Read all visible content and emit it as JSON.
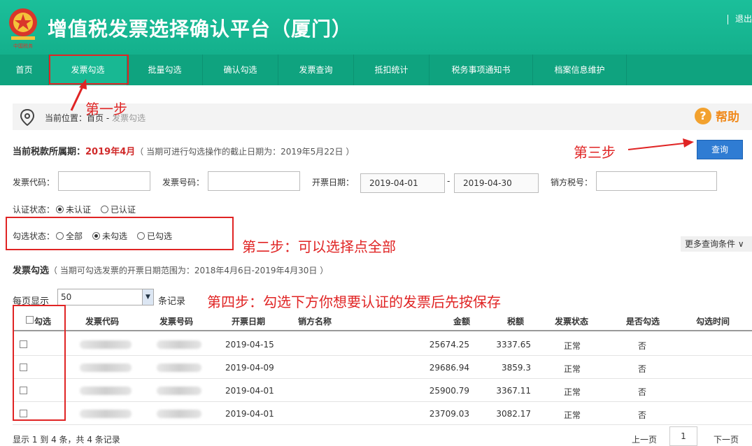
{
  "header": {
    "title": "增值税发票选择确认平台（厦门）",
    "exit": "退出",
    "emblem_text": "中国税务"
  },
  "nav": {
    "items": [
      {
        "label": "首页"
      },
      {
        "label": "发票勾选"
      },
      {
        "label": "批量勾选"
      },
      {
        "label": "确认勾选"
      },
      {
        "label": "发票查询"
      },
      {
        "label": "抵扣统计"
      },
      {
        "label": "税务事项通知书"
      },
      {
        "label": "档案信息维护"
      }
    ],
    "active_index": 1
  },
  "breadcrumb": {
    "prefix": "当前位置：首页 - ",
    "current": "发票勾选"
  },
  "help": {
    "icon": "?",
    "label": "帮助"
  },
  "period": {
    "label": "当前税款所属期：",
    "value": "2019年4月",
    "note": "（ 当期可进行勾选操作的截止日期为：2019年5月22日 ）"
  },
  "query_button": "查询",
  "form": {
    "invoice_code_label": "发票代码：",
    "invoice_no_label": "发票号码：",
    "date_label": "开票日期：",
    "date_from": "2019-04-01",
    "date_sep": "-",
    "date_to": "2019-04-30",
    "seller_tax_label": "销方税号：",
    "cert_label": "认证状态：",
    "cert_options": [
      "未认证",
      "已认证"
    ],
    "cert_selected": 0,
    "check_label": "勾选状态：",
    "check_options": [
      "全部",
      "未勾选",
      "已勾选"
    ],
    "check_selected": 1,
    "more_conditions": "更多查询条件 ∨"
  },
  "section": {
    "title": "发票勾选",
    "note": "（ 当期可勾选发票的开票日期范围为：2018年4月6日-2019年4月30日 ）"
  },
  "paging": {
    "per_page_label": "每页显示",
    "per_page_value": "50",
    "records_label": "条记录"
  },
  "table": {
    "headers": [
      "勾选",
      "发票代码",
      "发票号码",
      "开票日期",
      "销方名称",
      "金额",
      "税额",
      "发票状态",
      "是否勾选",
      "勾选时间"
    ],
    "rows": [
      {
        "date": "2019-04-15",
        "amount": "25674.25",
        "tax": "3337.65",
        "status": "正常",
        "checked": "否"
      },
      {
        "date": "2019-04-09",
        "amount": "29686.94",
        "tax": "3859.3",
        "status": "正常",
        "checked": "否"
      },
      {
        "date": "2019-04-01",
        "amount": "25900.79",
        "tax": "3367.11",
        "status": "正常",
        "checked": "否"
      },
      {
        "date": "2019-04-01",
        "amount": "23709.03",
        "tax": "3082.17",
        "status": "正常",
        "checked": "否"
      }
    ]
  },
  "footer": {
    "info": "显示 1 到 4 条，共 4 条记录",
    "prev": "上一页",
    "page": "1",
    "next": "下一页"
  },
  "annotations": {
    "step1": "第一步",
    "step2": "第二步：可以选择点全部",
    "step3": "第三步",
    "step4": "第四步：勾选下方你想要认证的发票后先按保存"
  },
  "colors": {
    "header": "#14b08c",
    "nav": "#0fa37f",
    "annotation": "#e02424",
    "query_button": "#2f7cd3",
    "period_highlight": "#d02a2a"
  }
}
